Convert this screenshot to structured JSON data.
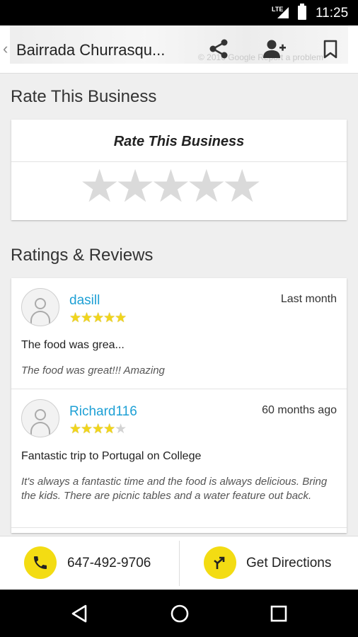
{
  "status_bar": {
    "network": "LTE",
    "time": "11:25"
  },
  "app_bar": {
    "title": "Bairrada Churrasqu...",
    "map_attribution": "© 2016 Google  Report a problem",
    "icons": [
      "back-chevron-icon",
      "share-icon",
      "add-contact-icon",
      "bookmark-icon"
    ]
  },
  "rate_section": {
    "heading": "Rate This Business",
    "card_title": "Rate This Business",
    "stars": "★★★★★"
  },
  "reviews_section": {
    "heading": "Ratings & Reviews",
    "reviews": [
      {
        "author": "dasill",
        "time": "Last month",
        "rating": 5,
        "stars_on": "★★★★★",
        "stars_off": "",
        "summary": "The food was grea...",
        "body": "The food was great!!! Amazing"
      },
      {
        "author": "Richard116",
        "time": "60 months ago",
        "rating": 4,
        "stars_on": "★★★★",
        "stars_off": "★",
        "summary": "Fantastic trip to Portugal on College",
        "body": "It's always a fantastic time and the food is always delicious. Bring the kids. There are picnic tables and a water feature out back."
      }
    ]
  },
  "action_bar": {
    "phone": "647-492-9706",
    "directions": "Get Directions",
    "accent_color": "#f3dc13"
  },
  "nav_bar": {
    "icons": [
      "back-triangle-icon",
      "home-circle-icon",
      "recents-square-icon"
    ]
  }
}
